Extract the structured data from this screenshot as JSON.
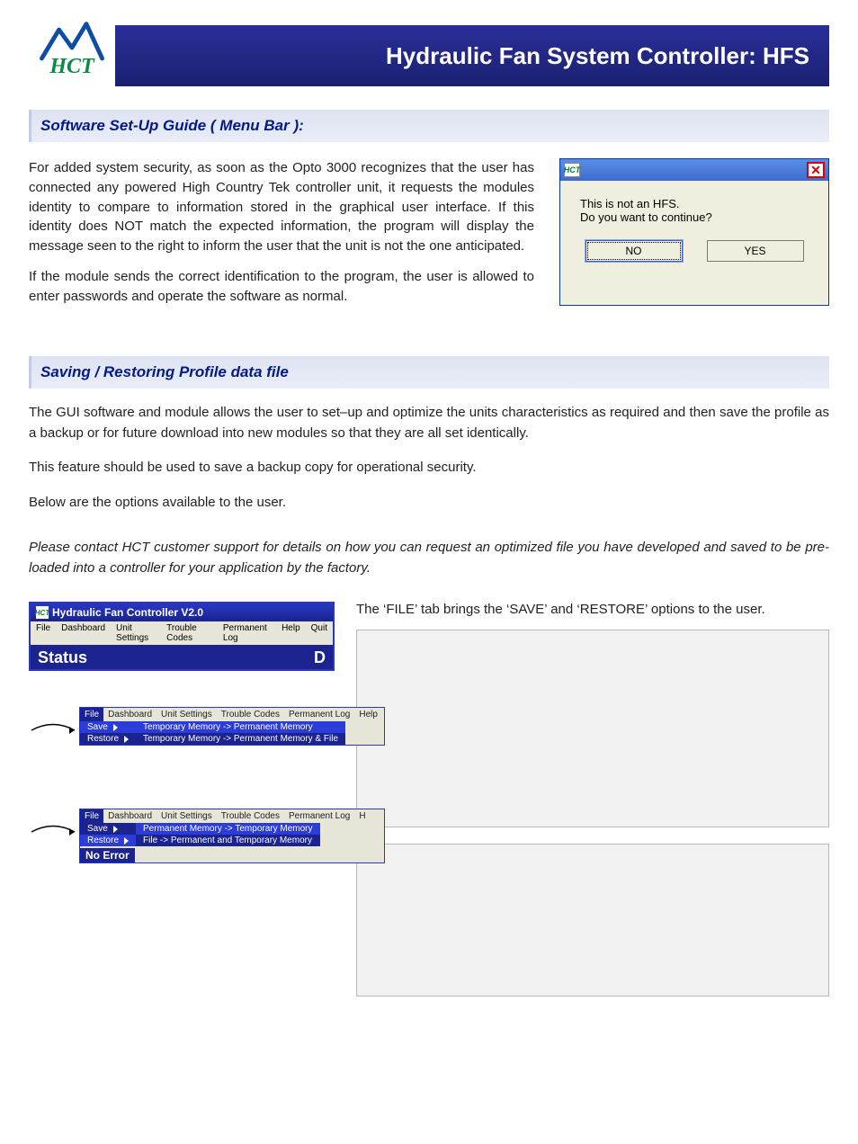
{
  "banner": {
    "title": "Hydraulic Fan System Controller: HFS",
    "logo_text": "HCT"
  },
  "section1": {
    "title": "Software Set-Up Guide ( Menu Bar ):"
  },
  "para1": "For added system security, as soon as the Opto 3000 recognizes that the user has connected any powered High Country Tek controller unit, it requests the modules identity to compare to information stored in the graphical user interface. If this identity does NOT match the expected information, the program will display the message seen to the right to inform the user that the unit is not the one anticipated.",
  "para2": "If the module sends the correct identification to the program, the user is allowed to enter passwords and operate the software as normal.",
  "dialog": {
    "icon_text": "HCT",
    "line1": "This is not an HFS.",
    "line2": "Do you want to continue?",
    "no": "NO",
    "yes": "YES"
  },
  "section2": {
    "title": "Saving  / Restoring Profile data file"
  },
  "para3": "The GUI software and module allows the user to set–up and optimize the units characteristics as required and then save the profile as a backup or for future download into new modules so that they are all set identically.",
  "para4": "This feature should be used to save a backup copy for operational security.",
  "para5": "Below are the options available to the user.",
  "para6": "Please contact HCT customer support for details on how you can request an optimized file you have developed and saved to be pre-loaded into a controller for your application by the factory.",
  "caption": "The ‘FILE’ tab brings the ‘SAVE’ and ‘RESTORE’ options to the user.",
  "app": {
    "title": "Hydraulic Fan Controller V2.0",
    "menu": [
      "File",
      "Dashboard",
      "Unit Settings",
      "Trouble Codes",
      "Permanent Log",
      "Help",
      "Quit"
    ],
    "status_left": "Status",
    "status_right": "D"
  },
  "mini1": {
    "menu": [
      "File",
      "Dashboard",
      "Unit Settings",
      "Trouble Codes",
      "Permanent Log",
      "Help"
    ],
    "save": "Save",
    "restore": "Restore",
    "sub1": "Temporary Memory -> Permanent Memory",
    "sub2": "Temporary Memory -> Permanent Memory & File"
  },
  "mini2": {
    "menu": [
      "File",
      "Dashboard",
      "Unit Settings",
      "Trouble Codes",
      "Permanent Log",
      "H"
    ],
    "save": "Save",
    "restore": "Restore",
    "sub1": "Permanent Memory -> Temporary Memory",
    "sub2": "File -> Permanent and Temporary Memory",
    "noerr": "No Error"
  }
}
